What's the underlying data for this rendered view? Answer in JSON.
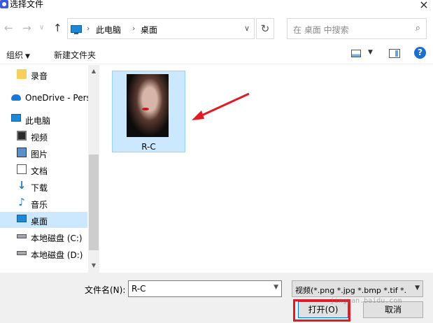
{
  "window": {
    "title": "选择文件",
    "close_glyph": "×"
  },
  "nav": {
    "back_glyph": "←",
    "forward_glyph": "→",
    "dropdown_glyph": "∨",
    "up_glyph": "↑",
    "breadcrumb": [
      "此电脑",
      "桌面"
    ],
    "separator": "›",
    "refresh_glyph": "↻",
    "search_placeholder": "在 桌面 中搜索",
    "search_glyph": "⌕"
  },
  "toolbar": {
    "organize": "组织",
    "new_folder": "新建文件夹",
    "help": "?"
  },
  "sidebar": {
    "items": [
      {
        "label": "录音",
        "icon": "folder-icon"
      },
      {
        "label": "OneDrive - Pers",
        "icon": "cloud-icon"
      },
      {
        "label": "此电脑",
        "icon": "pc-icon"
      },
      {
        "label": "视频",
        "icon": "video-icon"
      },
      {
        "label": "图片",
        "icon": "picture-icon"
      },
      {
        "label": "文档",
        "icon": "document-icon"
      },
      {
        "label": "下载",
        "icon": "download-icon",
        "glyph": "↓"
      },
      {
        "label": "音乐",
        "icon": "music-icon",
        "glyph": "♪"
      },
      {
        "label": "桌面",
        "icon": "desktop-icon",
        "selected": true
      },
      {
        "label": "本地磁盘 (C:)",
        "icon": "disk-icon"
      },
      {
        "label": "本地磁盘 (D:)",
        "icon": "disk-icon"
      }
    ]
  },
  "files": [
    {
      "name": "R-C",
      "selected": true
    }
  ],
  "bottom": {
    "filename_label": "文件名(N):",
    "filename_value": "R-C",
    "filetype": "视频(*.png *.jpg *.bmp *.tif *.",
    "open_label": "打开(O)",
    "cancel_label": "取消"
  },
  "watermark": "jingyan.baidu.com",
  "colors": {
    "accent": "#0078d7",
    "selection": "#cce8ff",
    "highlight_red": "#e01b24"
  }
}
